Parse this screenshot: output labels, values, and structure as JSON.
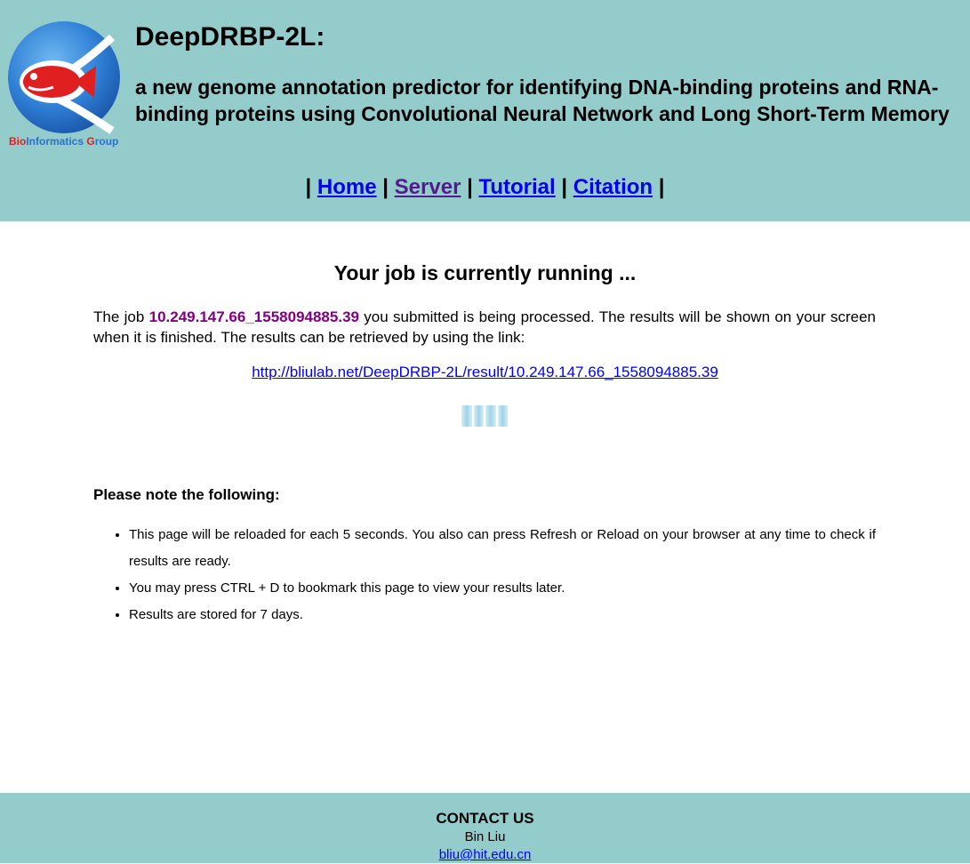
{
  "header": {
    "logo_text": "BioInformatics Group",
    "title": "DeepDRBP-2L:",
    "subtitle": "a new genome annotation predictor for identifying DNA-binding proteins and RNA-binding proteins using Convolutional Neural Network and Long Short-Term Memory",
    "bg_color": "#94cccc"
  },
  "nav": {
    "separator": "|",
    "items": [
      {
        "label": "Home"
      },
      {
        "label": "Server"
      },
      {
        "label": "Tutorial"
      },
      {
        "label": "Citation"
      }
    ]
  },
  "main": {
    "title": "Your job is currently running ...",
    "job_prefix": "The job ",
    "job_id": "10.249.147.66_1558094885.39",
    "job_suffix": " you submitted is being processed. The results will be shown on your screen when it is finished. The results can be retrieved by using the link:",
    "result_url": "http://bliulab.net/DeepDRBP-2L/result/10.249.147.66_1558094885.39",
    "note_title": "Please note the following:",
    "notes": [
      "This page will be reloaded for each 5 seconds. You also can press Refresh or Reload on your browser at any time to check if results are ready.",
      "You may press CTRL + D to bookmark this page to view your results later.",
      "Results are stored for 7 days."
    ]
  },
  "footer": {
    "title": "CONTACT US",
    "name": "Bin Liu",
    "email": "bliu@hit.edu.cn"
  }
}
